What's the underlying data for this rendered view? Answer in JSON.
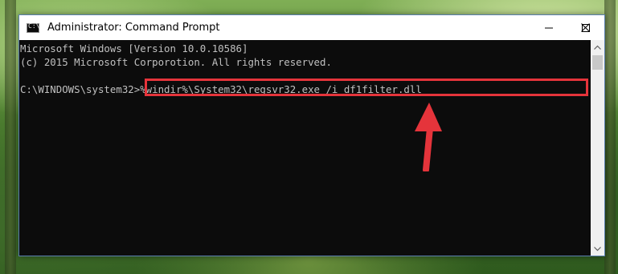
{
  "window": {
    "title": "Administrator: Command Prompt",
    "app_icon": "cmd-icon",
    "app_icon_glyph": "C:\\",
    "controls": [
      "minimize-icon",
      "maximize-icon",
      "close-icon"
    ]
  },
  "console": {
    "lines": [
      "Microsoft Windows [Version 10.0.10586]",
      "(c) 2015 Microsoft Corporotion. All rights reserved.",
      ""
    ],
    "prompt": "C:\\WINDOWS\\system32>",
    "command": "%windir%\\System32\\regsvr32.exe /i df1filter.dll"
  },
  "annotation": {
    "highlight_color": "#e5343b",
    "arrow_color": "#e5343b",
    "arrow_icon": "arrow-up-icon"
  },
  "scrollbar": {
    "up_icon": "chevron-up-icon",
    "down_icon": "chevron-down-icon"
  }
}
